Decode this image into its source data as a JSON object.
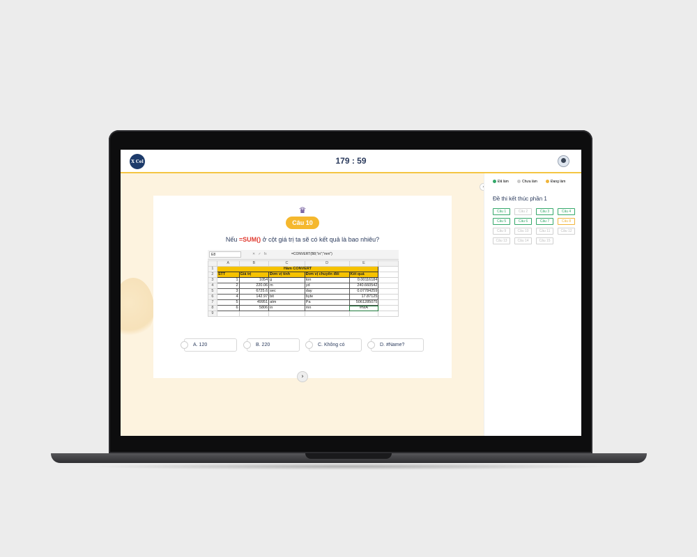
{
  "app": {
    "logo_text": "X Cel",
    "timer": "179 : 59"
  },
  "question": {
    "badge": "Câu 10",
    "text_before": "Nếu ",
    "highlight": "=SUM()",
    "text_after": " ở cột giá trị ta sẽ có kết quả là bao nhiêu?"
  },
  "sheet": {
    "cell_ref": "E8",
    "formula": "=CONVERT(B8;\"in\";\"mm\")",
    "col_headers": [
      "",
      "A",
      "B",
      "C",
      "D",
      "E"
    ],
    "title": "Hàm CONVERT",
    "headers": [
      "STT",
      "Giá trị",
      "Đơn vị tính",
      "Đơn vị chuyển đổi",
      "Kết quả"
    ],
    "rows": [
      {
        "n": "3",
        "stt": "1",
        "val": "1054",
        "from": "g",
        "to": "ton",
        "res": "0.00116184"
      },
      {
        "n": "4",
        "stt": "2",
        "val": "220.06",
        "from": "m",
        "to": "yd",
        "res": "240.660542"
      },
      {
        "n": "5",
        "stt": "3",
        "val": "6725.6",
        "from": "sec",
        "to": "day",
        "res": "0.07784259"
      },
      {
        "n": "6",
        "stt": "4",
        "val": "142.97",
        "from": "bit",
        "to": "byte",
        "res": "17.87125"
      },
      {
        "n": "7",
        "stt": "5",
        "val": "49951",
        "from": "atm",
        "to": "Pa",
        "res": "5061285075"
      },
      {
        "n": "8",
        "stt": "6",
        "val": "5806",
        "from": "in",
        "to": "mn",
        "res": "#N/A"
      }
    ],
    "row_labels": [
      "1",
      "2",
      "9"
    ]
  },
  "answers": [
    {
      "label": "A. 120"
    },
    {
      "label": "B. 220"
    },
    {
      "label": "C. Không có"
    },
    {
      "label": "D. #Name?"
    }
  ],
  "sidebar": {
    "legend": [
      {
        "label": "Đã làm",
        "color": "#34a86a"
      },
      {
        "label": "Chưa làm",
        "color": "#c9c9c9"
      },
      {
        "label": "Đang làm",
        "color": "#f0b43a"
      }
    ],
    "title": "Đề thi kết thúc phần 1",
    "questions": [
      {
        "label": "Câu 1",
        "status": "done"
      },
      {
        "label": "Câu 2",
        "status": "todo"
      },
      {
        "label": "Câu 3",
        "status": "done"
      },
      {
        "label": "Câu 4",
        "status": "done"
      },
      {
        "label": "Câu 5",
        "status": "done"
      },
      {
        "label": "Câu 6",
        "status": "done"
      },
      {
        "label": "Câu 7",
        "status": "done"
      },
      {
        "label": "Câu 8",
        "status": "current"
      },
      {
        "label": "Câu 9",
        "status": "todo"
      },
      {
        "label": "Câu 10",
        "status": "todo"
      },
      {
        "label": "Câu 11",
        "status": "todo"
      },
      {
        "label": "Câu 12",
        "status": "todo"
      },
      {
        "label": "Câu 13",
        "status": "todo"
      },
      {
        "label": "Câu 14",
        "status": "todo"
      },
      {
        "label": "Câu 15",
        "status": "todo"
      }
    ]
  }
}
